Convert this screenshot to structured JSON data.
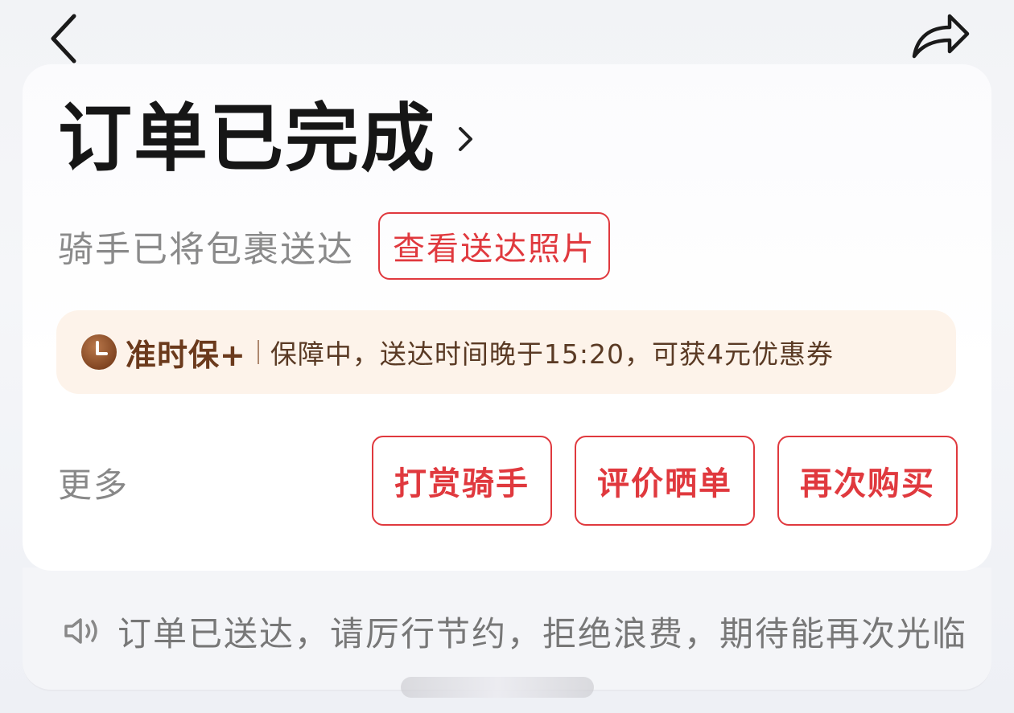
{
  "header": {
    "back_icon": "chevron-left-icon",
    "share_icon": "share-arrow-icon"
  },
  "status": {
    "title": "订单已完成",
    "chevron_icon": "chevron-right-icon"
  },
  "delivery": {
    "text": "骑手已将包裹送达",
    "photo_button": "查看送达照片"
  },
  "guarantee": {
    "icon": "clock-icon",
    "name": "准时保+",
    "description": "保障中，送达时间晚于15:20，可获4元优惠券"
  },
  "actions": {
    "more": "更多",
    "buttons": [
      "打赏骑手",
      "评价晒单",
      "再次购买"
    ]
  },
  "notice": {
    "icon": "speaker-icon",
    "text": "订单已送达，请厉行节约，拒绝浪费，期待能再次光临"
  },
  "colors": {
    "accent": "#e0393e",
    "guarantee_bg": "#fdf3ea",
    "guarantee_text": "#6b3a1c"
  }
}
